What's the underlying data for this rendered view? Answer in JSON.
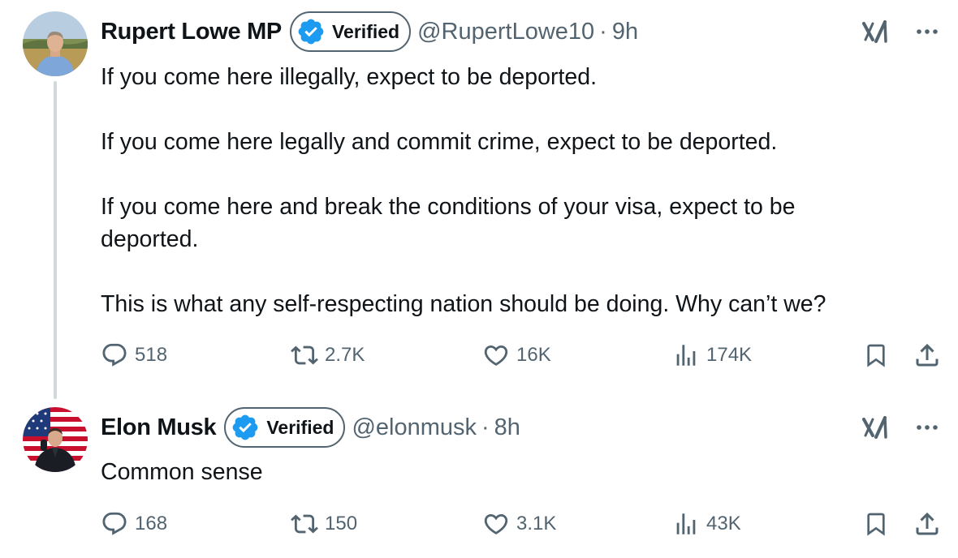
{
  "tweets": [
    {
      "author_name": "Rupert Lowe MP",
      "verified_label": "Verified",
      "handle": "@RupertLowe10",
      "separator": "·",
      "time": "9h",
      "paragraphs": [
        "If you come here illegally, expect to be deported.",
        "If you come here legally and commit crime, expect to be deported.",
        "If you come here and break the conditions of your visa, expect to be deported.",
        "This is what any self-respecting nation should be doing. Why can’t we?"
      ],
      "replies": "518",
      "reposts": "2.7K",
      "likes": "16K",
      "views": "174K"
    },
    {
      "author_name": "Elon Musk",
      "verified_label": "Verified",
      "handle": "@elonmusk",
      "separator": "·",
      "time": "8h",
      "paragraphs": [
        "Common sense"
      ],
      "replies": "168",
      "reposts": "150",
      "likes": "3.1K",
      "views": "43K"
    }
  ],
  "icons": {
    "verified": "verified-badge-icon",
    "grok": "grok-icon",
    "more": "more-icon",
    "reply": "reply-icon",
    "repost": "repost-icon",
    "like": "like-icon",
    "views": "views-icon",
    "bookmark": "bookmark-icon",
    "share": "share-icon"
  },
  "colors": {
    "verified_blue": "#1d9bf0",
    "secondary_text": "#536471",
    "primary_text": "#0f1419",
    "thread_line": "#cfd9de"
  }
}
